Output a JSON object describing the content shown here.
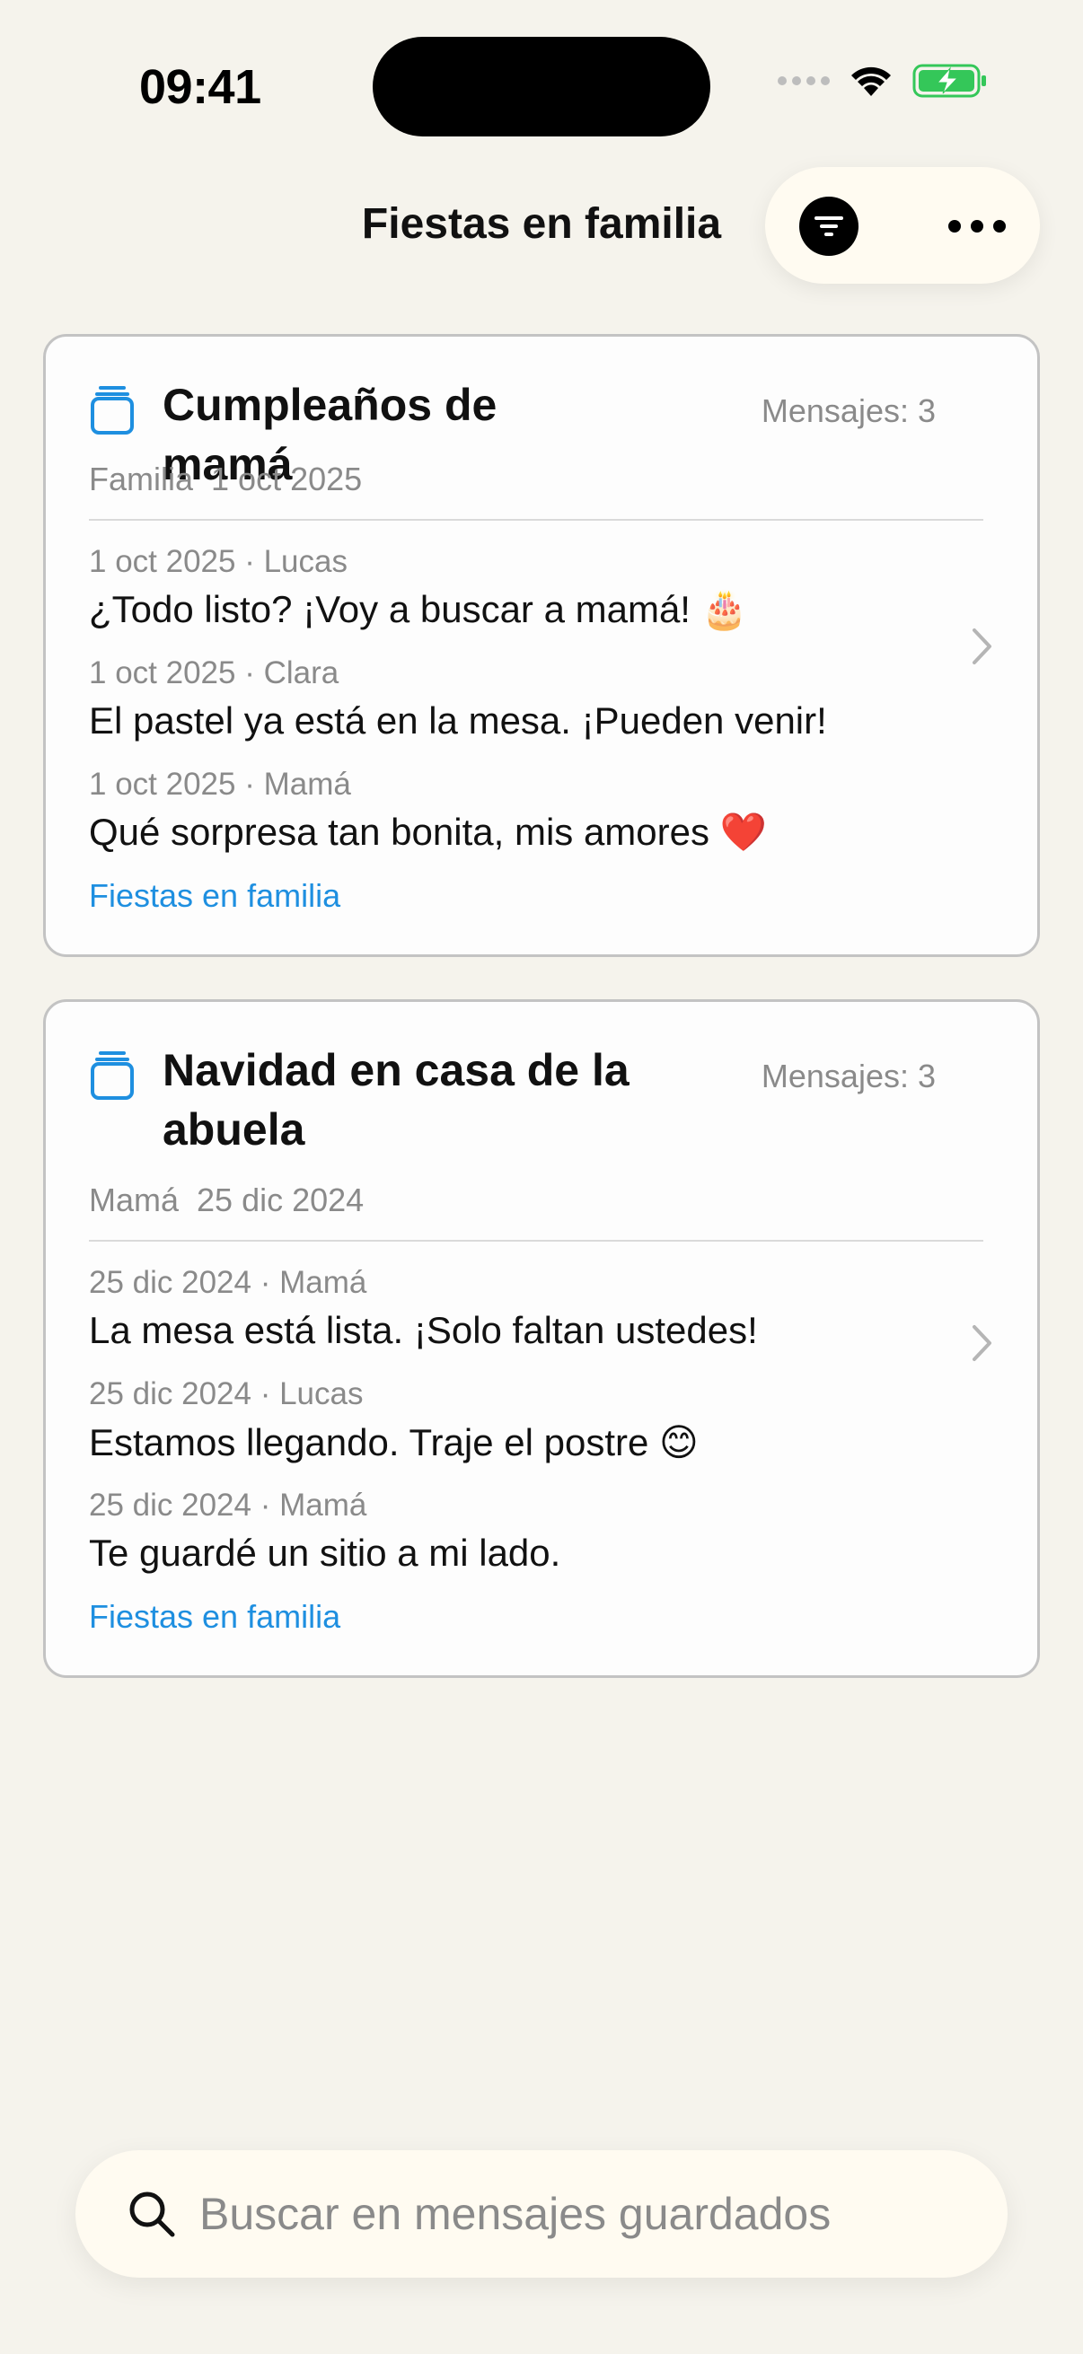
{
  "status_bar": {
    "time": "09:41"
  },
  "header": {
    "title": "Fiestas en familia"
  },
  "events": [
    {
      "title": "Cumpleaños de mamá",
      "message_count": "Mensajes: 3",
      "meta": "Familia  1 oct 2025",
      "messages": [
        {
          "header": "1 oct 2025 · Lucas",
          "text": "¿Todo listo? ¡Voy a buscar a mamá! 🎂"
        },
        {
          "header": "1 oct 2025 · Clara",
          "text": "El pastel ya está en la mesa. ¡Pueden venir!"
        },
        {
          "header": "1 oct 2025 · Mamá",
          "text": "Qué sorpresa tan bonita, mis amores ❤️"
        }
      ],
      "tag": "Fiestas en familia"
    },
    {
      "title": "Navidad en casa de la abuela",
      "message_count": "Mensajes: 3",
      "meta": "Mamá  25 dic 2024",
      "messages": [
        {
          "header": "25 dic 2024 · Mamá",
          "text": "La mesa está lista. ¡Solo faltan ustedes!"
        },
        {
          "header": "25 dic 2024 · Lucas",
          "text": "Estamos llegando. Traje el postre 😊"
        },
        {
          "header": "25 dic 2024 · Mamá",
          "text": "Te guardé un sitio a mi lado."
        }
      ],
      "tag": "Fiestas en familia"
    }
  ],
  "search": {
    "placeholder": "Buscar en mensajes guardados"
  },
  "icons": {
    "folder": "folder-stack-icon",
    "filter": "filter-icon",
    "more": "more-icon",
    "chevron": "chevron-right-icon",
    "search": "search-icon",
    "wifi": "wifi-icon",
    "battery": "battery-charging-icon"
  },
  "colors": {
    "background": "#F5F3EC",
    "accent": "#1E8FE0",
    "battery": "#34C759"
  }
}
